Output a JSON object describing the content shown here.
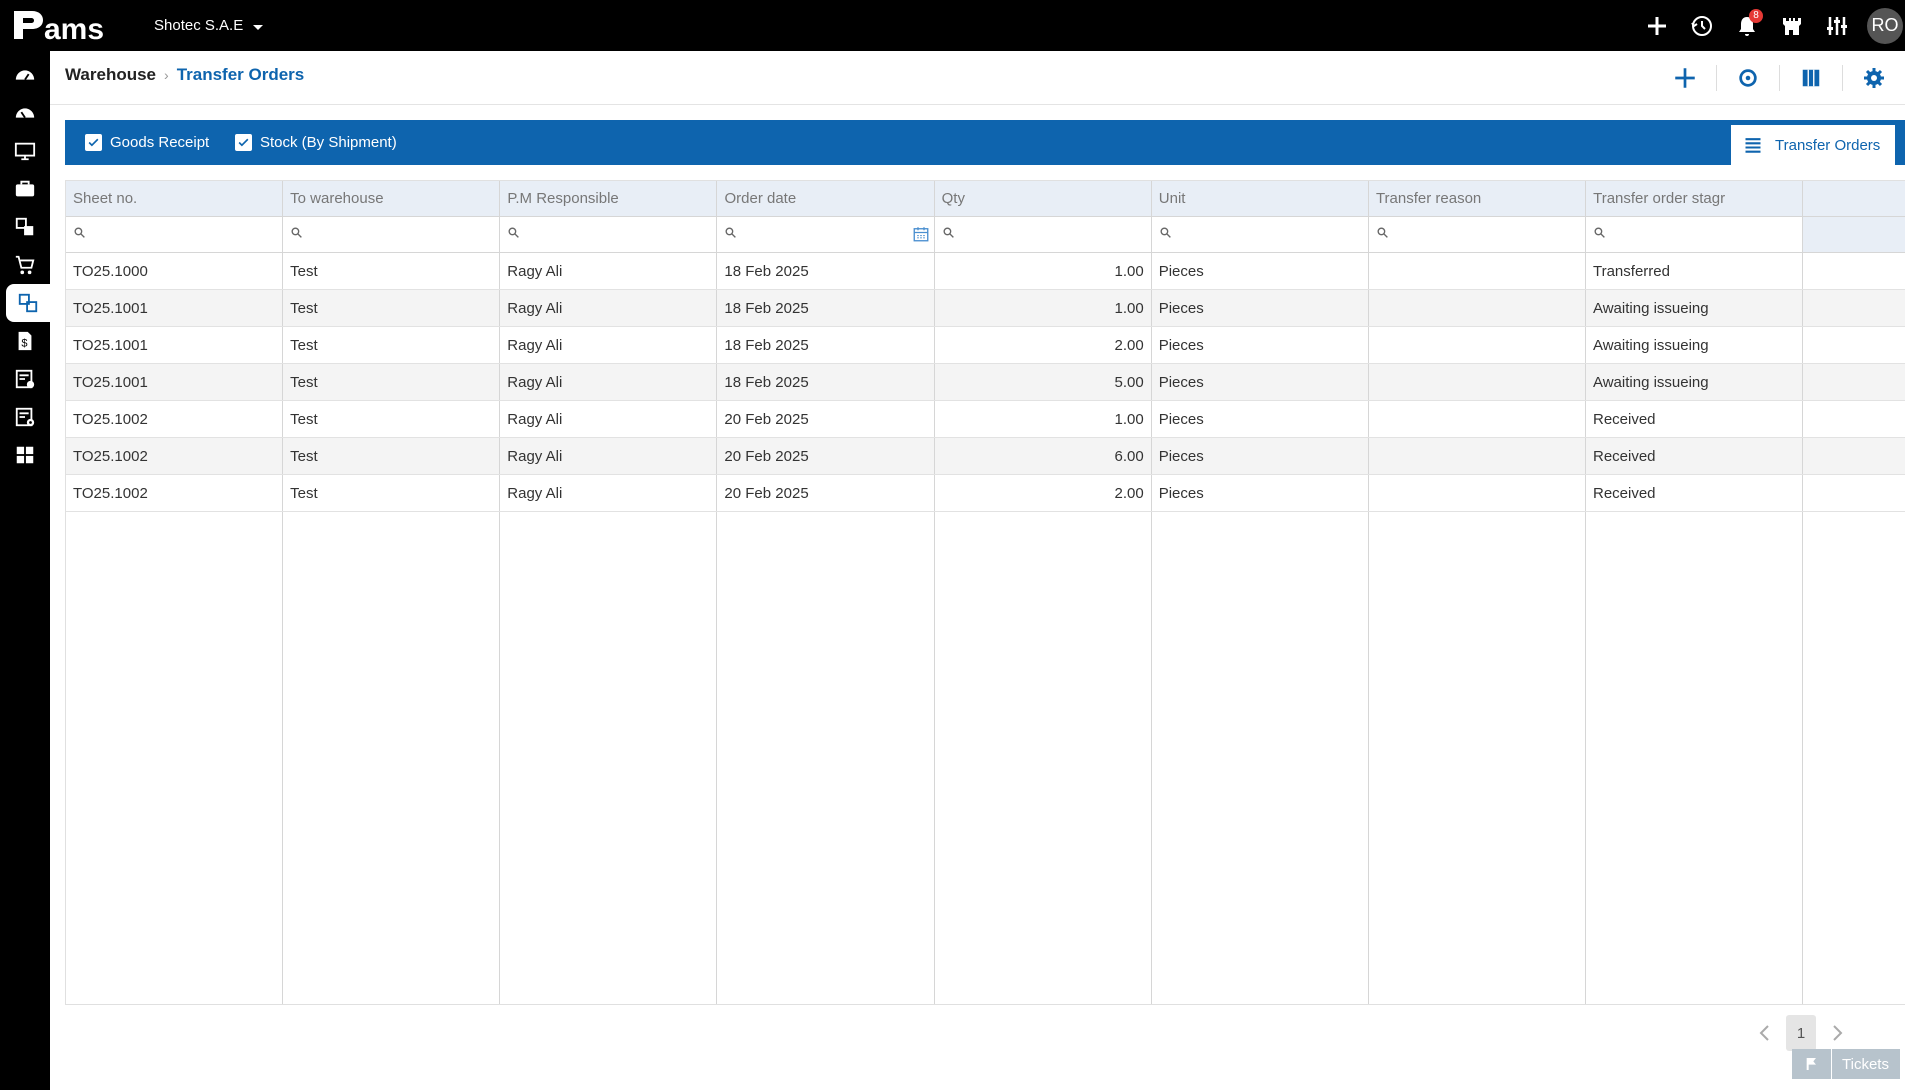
{
  "app": {
    "logo_text": "Pams",
    "company": "Shotec S.A.E",
    "notification_count": "8",
    "avatar_initials": "RO"
  },
  "topbar_icons": [
    "add-icon",
    "history-icon",
    "bell-icon",
    "castle-icon",
    "sliders-icon"
  ],
  "sidebar_icons": [
    "dashboard-icon",
    "dashboard-alt-icon",
    "monitor-icon",
    "briefcase-icon",
    "warehouse-transfer-icon",
    "cart-icon",
    "transfer-orders-icon",
    "money-document-icon",
    "checklist-icon",
    "settings-document-icon",
    "grid-apps-icon"
  ],
  "breadcrumb": {
    "root": "Warehouse",
    "current": "Transfer Orders"
  },
  "tabs": {
    "checks": [
      {
        "label": "Goods Receipt",
        "checked": true
      },
      {
        "label": "Stock (By Shipment)",
        "checked": true
      }
    ],
    "active_label": "Transfer Orders"
  },
  "grid": {
    "columns": [
      "Sheet no.",
      "To warehouse",
      "P.M Responsible",
      "Order date",
      "Qty",
      "Unit",
      "Transfer reason",
      "Transfer order stagr"
    ],
    "rows": [
      [
        "TO25.1000",
        "Test",
        "Ragy Ali",
        "18 Feb 2025",
        "1.00",
        "Pieces",
        "",
        "Transferred"
      ],
      [
        "TO25.1001",
        "Test",
        "Ragy Ali",
        "18 Feb 2025",
        "1.00",
        "Pieces",
        "",
        "Awaiting issueing"
      ],
      [
        "TO25.1001",
        "Test",
        "Ragy Ali",
        "18 Feb 2025",
        "2.00",
        "Pieces",
        "",
        "Awaiting issueing"
      ],
      [
        "TO25.1001",
        "Test",
        "Ragy Ali",
        "18 Feb 2025",
        "5.00",
        "Pieces",
        "",
        "Awaiting issueing"
      ],
      [
        "TO25.1002",
        "Test",
        "Ragy Ali",
        "20 Feb 2025",
        "1.00",
        "Pieces",
        "",
        "Received"
      ],
      [
        "TO25.1002",
        "Test",
        "Ragy Ali",
        "20 Feb 2025",
        "6.00",
        "Pieces",
        "",
        "Received"
      ],
      [
        "TO25.1002",
        "Test",
        "Ragy Ali",
        "20 Feb 2025",
        "2.00",
        "Pieces",
        "",
        "Received"
      ]
    ]
  },
  "pager": {
    "current_page": "1"
  },
  "tickets_label": "Tickets",
  "colors": {
    "brand_blue": "#0e64ae",
    "header_bg": "#000000",
    "grid_header": "#e8eef6"
  }
}
